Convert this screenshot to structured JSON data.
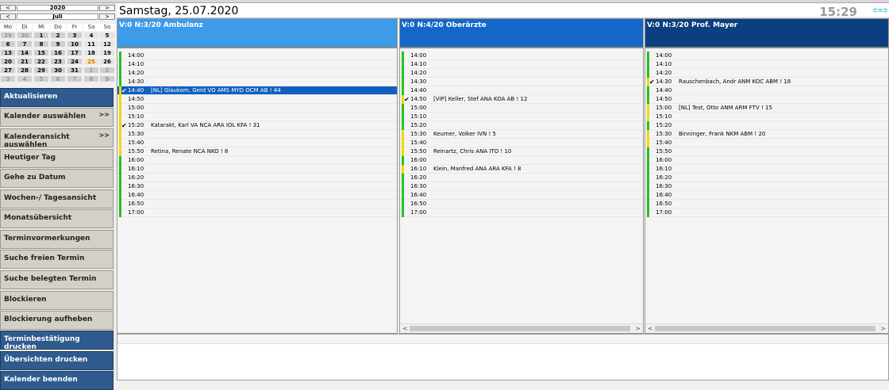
{
  "calendar": {
    "year": "2020",
    "month": "Juli",
    "prev": "<",
    "next": ">",
    "weekdays": [
      "Mo",
      "Di",
      "Mi",
      "Do",
      "Fr",
      "Sa",
      "So"
    ],
    "days": [
      [
        "29",
        "30",
        "1",
        "2",
        "3",
        "4",
        "5"
      ],
      [
        "6",
        "7",
        "8",
        "9",
        "10",
        "11",
        "12"
      ],
      [
        "13",
        "14",
        "15",
        "16",
        "17",
        "18",
        "19"
      ],
      [
        "20",
        "21",
        "22",
        "23",
        "24",
        "25",
        "26"
      ],
      [
        "27",
        "28",
        "29",
        "30",
        "31",
        "1",
        "2"
      ],
      [
        "3",
        "4",
        "5",
        "6",
        "7",
        "8",
        "9"
      ]
    ]
  },
  "menu": [
    {
      "label": "Aktualisieren",
      "style": "blue",
      "arrow": ""
    },
    {
      "label": "Kalender auswählen",
      "style": "gray",
      "arrow": ">>"
    },
    {
      "label": "Kalenderansicht auswählen",
      "style": "gray",
      "arrow": ">>"
    },
    {
      "label": "Heutiger Tag",
      "style": "gray",
      "arrow": ""
    },
    {
      "label": "Gehe zu Datum",
      "style": "gray",
      "arrow": ""
    },
    {
      "label": "Wochen-/ Tagesansicht",
      "style": "gray",
      "arrow": ""
    },
    {
      "label": "Monatsübersicht",
      "style": "gray",
      "arrow": ""
    },
    {
      "label": "Terminvormerkungen",
      "style": "gray",
      "arrow": ""
    },
    {
      "label": "Suche freien Termin",
      "style": "gray",
      "arrow": ""
    },
    {
      "label": "Suche belegten Termin",
      "style": "gray",
      "arrow": ""
    },
    {
      "label": "Blockieren",
      "style": "gray",
      "arrow": ""
    },
    {
      "label": "Blockierung aufheben",
      "style": "gray",
      "arrow": ""
    },
    {
      "label": "Terminbestätigung drucken",
      "style": "blue",
      "arrow": ""
    },
    {
      "label": "Übersichten drucken",
      "style": "blue",
      "arrow": ""
    },
    {
      "label": "Kalender beenden",
      "style": "blue",
      "arrow": ""
    }
  ],
  "header": {
    "date": "Samstag, 25.07.2020",
    "clock": "15:29",
    "nav_arrows": "⇦⇨"
  },
  "columns": [
    {
      "title": "V:0 N:3/20  Ambulanz",
      "color": "#3d9be9",
      "scroll": false,
      "slots": [
        {
          "time": "14:00",
          "name": "",
          "bar": "g",
          "check": false,
          "sel": false
        },
        {
          "time": "14:10",
          "name": "",
          "bar": "g",
          "check": false,
          "sel": false
        },
        {
          "time": "14:20",
          "name": "",
          "bar": "g",
          "check": false,
          "sel": false
        },
        {
          "time": "14:30",
          "name": "",
          "bar": "g",
          "check": false,
          "sel": false
        },
        {
          "time": "14:40",
          "name": "[NL] Glaukom, Gerd VO AMS MYD OCM AB ! 44",
          "bar": "y",
          "check": true,
          "sel": true
        },
        {
          "time": "14:50",
          "name": "",
          "bar": "y",
          "check": false,
          "sel": false
        },
        {
          "time": "15:00",
          "name": "",
          "bar": "y",
          "check": false,
          "sel": false
        },
        {
          "time": "15:10",
          "name": "",
          "bar": "y",
          "check": false,
          "sel": false
        },
        {
          "time": "15:20",
          "name": "Katarakt, Karl VA NCA ARA IOL KFA ! 31",
          "bar": "y",
          "check": true,
          "sel": false
        },
        {
          "time": "15:30",
          "name": "",
          "bar": "y",
          "check": false,
          "sel": false
        },
        {
          "time": "15:40",
          "name": "",
          "bar": "y",
          "check": false,
          "sel": false
        },
        {
          "time": "15:50",
          "name": "Retina, Renate NCA NKO    ! 8",
          "bar": "y",
          "check": false,
          "sel": false
        },
        {
          "time": "16:00",
          "name": "",
          "bar": "g",
          "check": false,
          "sel": false
        },
        {
          "time": "16:10",
          "name": "",
          "bar": "g",
          "check": false,
          "sel": false
        },
        {
          "time": "16:20",
          "name": "",
          "bar": "g",
          "check": false,
          "sel": false
        },
        {
          "time": "16:30",
          "name": "",
          "bar": "g",
          "check": false,
          "sel": false
        },
        {
          "time": "16:40",
          "name": "",
          "bar": "g",
          "check": false,
          "sel": false
        },
        {
          "time": "16:50",
          "name": "",
          "bar": "g",
          "check": false,
          "sel": false
        },
        {
          "time": "17:00",
          "name": "",
          "bar": "g",
          "check": false,
          "sel": false
        }
      ]
    },
    {
      "title": "V:0 N:4/20  Oberärzte",
      "color": "#1467c8",
      "scroll": true,
      "slots": [
        {
          "time": "14:00",
          "name": "",
          "bar": "g",
          "check": false,
          "sel": false
        },
        {
          "time": "14:10",
          "name": "",
          "bar": "g",
          "check": false,
          "sel": false
        },
        {
          "time": "14:20",
          "name": "",
          "bar": "g",
          "check": false,
          "sel": false
        },
        {
          "time": "14:30",
          "name": "",
          "bar": "g",
          "check": false,
          "sel": false
        },
        {
          "time": "14:40",
          "name": "",
          "bar": "g",
          "check": false,
          "sel": false
        },
        {
          "time": "14:50",
          "name": "[VIP] Keller, Stef ANA KOA AB   ! 12",
          "bar": "y",
          "check": true,
          "sel": false
        },
        {
          "time": "15:00",
          "name": "",
          "bar": "g",
          "check": false,
          "sel": false
        },
        {
          "time": "15:10",
          "name": "",
          "bar": "g",
          "check": false,
          "sel": false
        },
        {
          "time": "15:20",
          "name": "",
          "bar": "g",
          "check": false,
          "sel": false
        },
        {
          "time": "15:30",
          "name": "Keumer, Volker IVN     ! 5",
          "bar": "y",
          "check": false,
          "sel": false
        },
        {
          "time": "15:40",
          "name": "",
          "bar": "y",
          "check": false,
          "sel": false
        },
        {
          "time": "15:50",
          "name": "Reinartz, Chris ANA ITO   ! 10",
          "bar": "y",
          "check": false,
          "sel": false
        },
        {
          "time": "16:00",
          "name": "",
          "bar": "g",
          "check": false,
          "sel": false
        },
        {
          "time": "16:10",
          "name": "Klein, Manfred ANA ARA KFA   ! 8",
          "bar": "y",
          "check": false,
          "sel": false
        },
        {
          "time": "16:20",
          "name": "",
          "bar": "g",
          "check": false,
          "sel": false
        },
        {
          "time": "16:30",
          "name": "",
          "bar": "g",
          "check": false,
          "sel": false
        },
        {
          "time": "16:40",
          "name": "",
          "bar": "g",
          "check": false,
          "sel": false
        },
        {
          "time": "16:50",
          "name": "",
          "bar": "g",
          "check": false,
          "sel": false
        },
        {
          "time": "17:00",
          "name": "",
          "bar": "g",
          "check": false,
          "sel": false
        }
      ]
    },
    {
      "title": "V:0 N:3/20  Prof. Mayer",
      "color": "#0b3f80",
      "scroll": true,
      "slots": [
        {
          "time": "14:00",
          "name": "",
          "bar": "g",
          "check": false,
          "sel": false
        },
        {
          "time": "14:10",
          "name": "",
          "bar": "g",
          "check": false,
          "sel": false
        },
        {
          "time": "14:20",
          "name": "",
          "bar": "g",
          "check": false,
          "sel": false
        },
        {
          "time": "14:30",
          "name": "Rauschenbach, Andr ANM KOC ABM   ! 18",
          "bar": "y",
          "check": true,
          "sel": false
        },
        {
          "time": "14:40",
          "name": "",
          "bar": "g",
          "check": false,
          "sel": false
        },
        {
          "time": "14:50",
          "name": "",
          "bar": "g",
          "check": false,
          "sel": false
        },
        {
          "time": "15:00",
          "name": "[NL] Test, Otto ANM ARM FTV   ! 15",
          "bar": "y",
          "check": false,
          "sel": false
        },
        {
          "time": "15:10",
          "name": "",
          "bar": "y",
          "check": false,
          "sel": false
        },
        {
          "time": "15:20",
          "name": "",
          "bar": "g",
          "check": false,
          "sel": false
        },
        {
          "time": "15:30",
          "name": "Binninger, Frank NKM ABM   ! 20",
          "bar": "y",
          "check": false,
          "sel": false
        },
        {
          "time": "15:40",
          "name": "",
          "bar": "y",
          "check": false,
          "sel": false
        },
        {
          "time": "15:50",
          "name": "",
          "bar": "g",
          "check": false,
          "sel": false
        },
        {
          "time": "16:00",
          "name": "",
          "bar": "g",
          "check": false,
          "sel": false
        },
        {
          "time": "16:10",
          "name": "",
          "bar": "g",
          "check": false,
          "sel": false
        },
        {
          "time": "16:20",
          "name": "",
          "bar": "g",
          "check": false,
          "sel": false
        },
        {
          "time": "16:30",
          "name": "",
          "bar": "g",
          "check": false,
          "sel": false
        },
        {
          "time": "16:40",
          "name": "",
          "bar": "g",
          "check": false,
          "sel": false
        },
        {
          "time": "16:50",
          "name": "",
          "bar": "g",
          "check": false,
          "sel": false
        },
        {
          "time": "17:00",
          "name": "",
          "bar": "g",
          "check": false,
          "sel": false
        }
      ]
    }
  ],
  "scrollbar": {
    "left": "<",
    "right": ">"
  },
  "checkmark": "✔"
}
